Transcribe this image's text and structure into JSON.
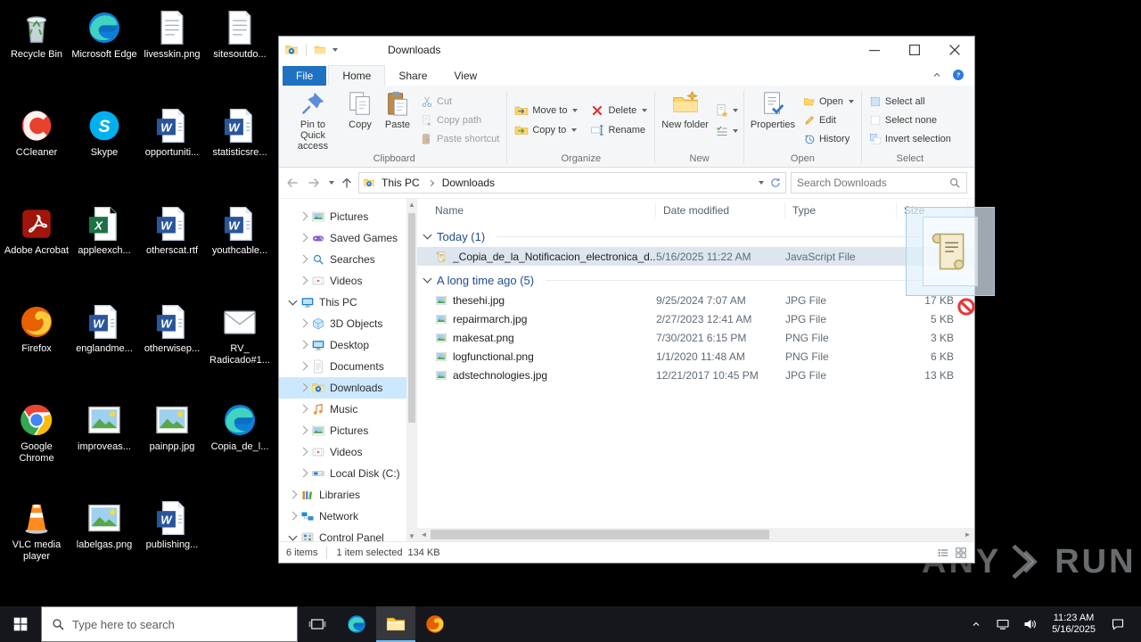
{
  "desktop": {
    "icons": [
      {
        "label": "Recycle Bin",
        "icon": "recycle-bin"
      },
      {
        "label": "CCleaner",
        "icon": "ccleaner"
      },
      {
        "label": "Adobe Acrobat",
        "icon": "acrobat"
      },
      {
        "label": "Firefox",
        "icon": "firefox"
      },
      {
        "label": "Google Chrome",
        "icon": "chrome"
      },
      {
        "label": "VLC media player",
        "icon": "vlc"
      },
      {
        "label": "Microsoft Edge",
        "icon": "edge"
      },
      {
        "label": "Skype",
        "icon": "skype"
      },
      {
        "label": "appleexch...",
        "icon": "excel"
      },
      {
        "label": "englandme...",
        "icon": "word"
      },
      {
        "label": "improveas...",
        "icon": "image"
      },
      {
        "label": "labelgas.png",
        "icon": "image"
      },
      {
        "label": "livesskin.png",
        "icon": "notepage"
      },
      {
        "label": "opportuniti...",
        "icon": "word"
      },
      {
        "label": "otherscat.rtf",
        "icon": "word"
      },
      {
        "label": "otherwisep...",
        "icon": "word"
      },
      {
        "label": "painpp.jpg",
        "icon": "image"
      },
      {
        "label": "publishing...",
        "icon": "word"
      },
      {
        "label": "sitesoutdo...",
        "icon": "notepage"
      },
      {
        "label": "statisticsre...",
        "icon": "word"
      },
      {
        "label": "youthcable...",
        "icon": "word"
      },
      {
        "label": "RV_ Radicado#1...",
        "icon": "email"
      },
      {
        "label": "Copia_de_l...",
        "icon": "edge"
      }
    ]
  },
  "window": {
    "title": "Downloads",
    "tabs": {
      "file": "File",
      "home": "Home",
      "share": "Share",
      "view": "View"
    },
    "ribbon": {
      "pin": "Pin to Quick access",
      "copy": "Copy",
      "paste": "Paste",
      "cut": "Cut",
      "copy_path": "Copy path",
      "paste_shortcut": "Paste shortcut",
      "clipboard": "Clipboard",
      "move_to": "Move to",
      "delete": "Delete",
      "copy_to": "Copy to",
      "rename": "Rename",
      "organize": "Organize",
      "new_folder": "New folder",
      "new": "New",
      "properties": "Properties",
      "open": "Open",
      "edit": "Edit",
      "history": "History",
      "open_group": "Open",
      "select_all": "Select all",
      "select_none": "Select none",
      "invert_selection": "Invert selection",
      "select": "Select"
    },
    "address": {
      "crumb1": "This PC",
      "crumb2": "Downloads",
      "search_placeholder": "Search Downloads"
    },
    "nav": {
      "items": [
        {
          "label": "Pictures",
          "icon": "pictures"
        },
        {
          "label": "Saved Games",
          "icon": "saved-games"
        },
        {
          "label": "Searches",
          "icon": "searches"
        },
        {
          "label": "Videos",
          "icon": "videos"
        },
        {
          "label": "This PC",
          "icon": "this-pc"
        },
        {
          "label": "3D Objects",
          "icon": "3d-objects"
        },
        {
          "label": "Desktop",
          "icon": "desktop"
        },
        {
          "label": "Documents",
          "icon": "documents"
        },
        {
          "label": "Downloads",
          "icon": "downloads"
        },
        {
          "label": "Music",
          "icon": "music"
        },
        {
          "label": "Pictures",
          "icon": "pictures"
        },
        {
          "label": "Videos",
          "icon": "videos"
        },
        {
          "label": "Local Disk (C:)",
          "icon": "disk"
        },
        {
          "label": "Libraries",
          "icon": "libraries"
        },
        {
          "label": "Network",
          "icon": "network"
        },
        {
          "label": "Control Panel",
          "icon": "control-panel"
        }
      ]
    },
    "list": {
      "columns": {
        "name": "Name",
        "date": "Date modified",
        "type": "Type",
        "size": "Size"
      },
      "groups": [
        {
          "label": "Today (1)"
        },
        {
          "label": "A long time ago (5)"
        }
      ],
      "files": [
        {
          "name": "_Copia_de_la_Notificacion_electronica_d...",
          "date": "5/16/2025 11:22 AM",
          "type": "JavaScript File",
          "size": "",
          "icon": "js-file"
        },
        {
          "name": "thesehi.jpg",
          "date": "9/25/2024 7:07 AM",
          "type": "JPG File",
          "size": "17 KB",
          "icon": "image-file"
        },
        {
          "name": "repairmarch.jpg",
          "date": "2/27/2023 12:41 AM",
          "type": "JPG File",
          "size": "5 KB",
          "icon": "image-file"
        },
        {
          "name": "makesat.png",
          "date": "7/30/2021 6:15 PM",
          "type": "PNG File",
          "size": "3 KB",
          "icon": "image-file"
        },
        {
          "name": "logfunctional.png",
          "date": "1/1/2020 11:48 AM",
          "type": "PNG File",
          "size": "6 KB",
          "icon": "image-file"
        },
        {
          "name": "adstechnologies.jpg",
          "date": "12/21/2017 10:45 PM",
          "type": "JPG File",
          "size": "13 KB",
          "icon": "image-file"
        }
      ]
    },
    "status": {
      "items": "6 items",
      "selected": "1 item selected",
      "size": "134 KB"
    }
  },
  "taskbar": {
    "search_placeholder": "Type here to search",
    "time": "11:23 AM",
    "date": "5/16/2025"
  },
  "watermark": {
    "left": "ANY",
    "right": "RUN"
  },
  "colors": {
    "accent_blue": "#1f72c2",
    "selection_blue": "#cce8ff",
    "taskbar": "#15171c",
    "delete_red": "#d23b3b"
  }
}
